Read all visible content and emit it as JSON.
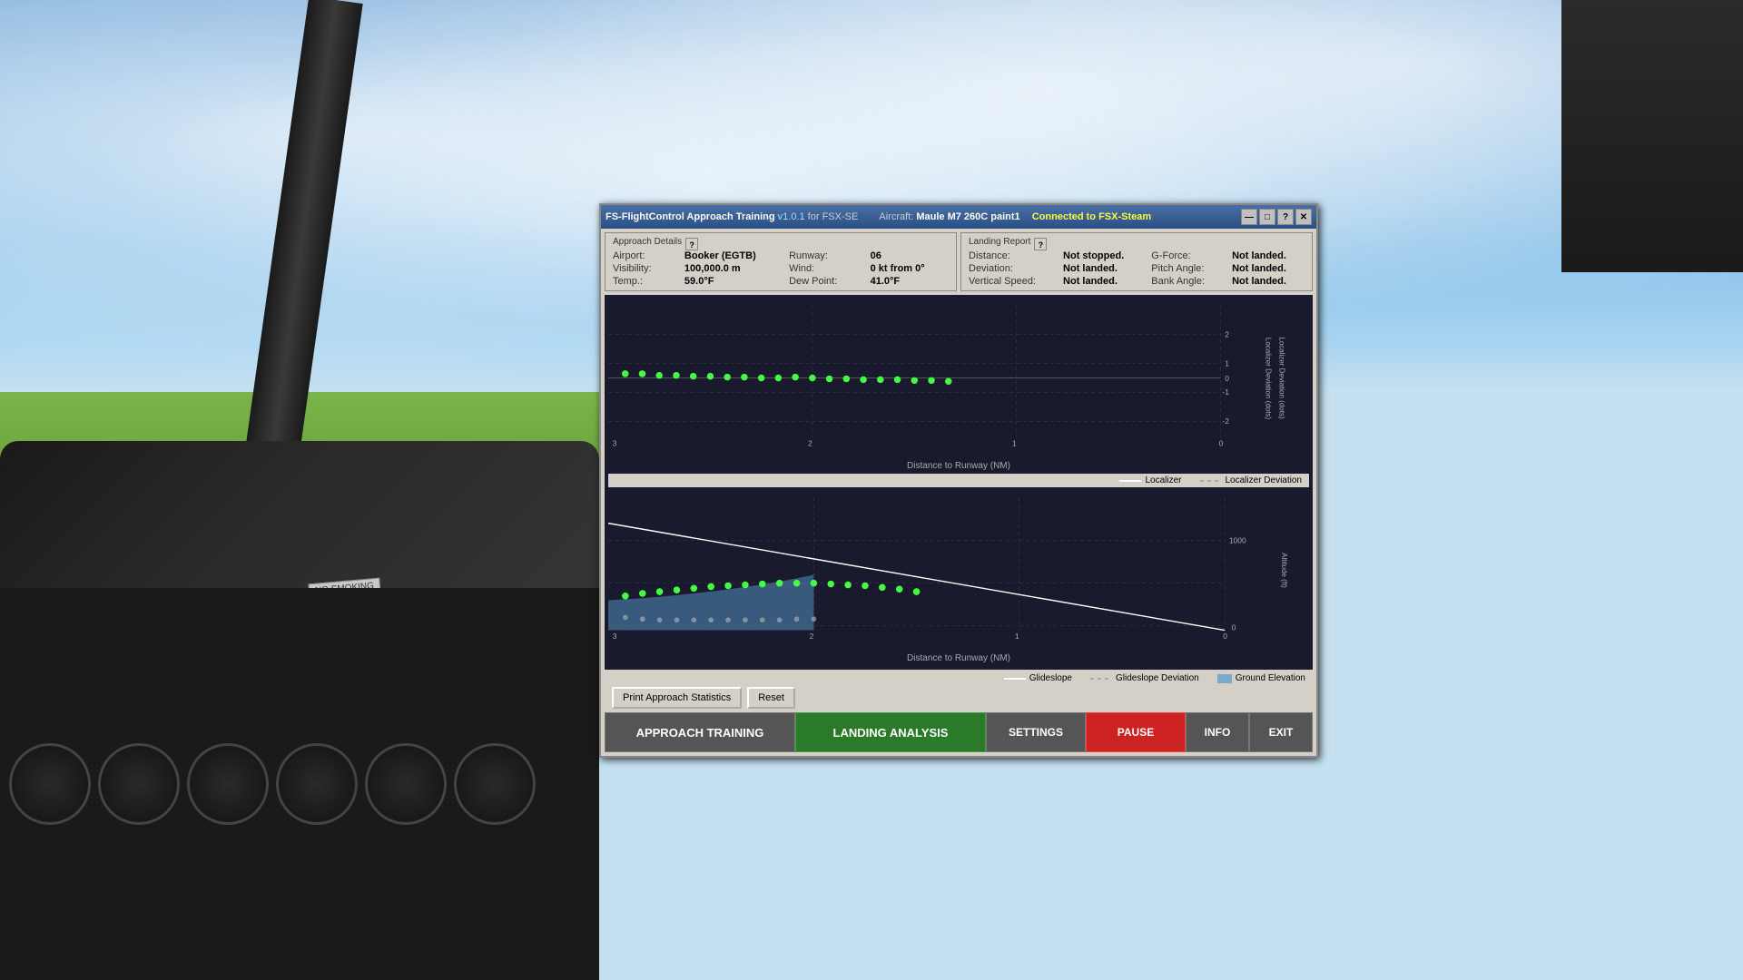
{
  "background": {
    "sky_color": "#6ba3d6",
    "ground_color": "#5a8c30"
  },
  "title_bar": {
    "app_name": "FS-FlightControl Approach Training",
    "version": "v1.0.1",
    "for_label": "for",
    "sim": "FSX-SE",
    "aircraft_label": "Aircraft:",
    "aircraft_name": "Maule M7 260C paint1",
    "connected_label": "Connected to FSX-Steam",
    "minimize_label": "—",
    "restore_label": "□",
    "help_label": "?",
    "close_label": "✕"
  },
  "approach_details": {
    "title": "Approach Details",
    "airport_label": "Airport:",
    "airport_value": "Booker (EGTB)",
    "runway_label": "Runway:",
    "runway_value": "06",
    "visibility_label": "Visibility:",
    "visibility_value": "100,000.0 m",
    "wind_label": "Wind:",
    "wind_value": "0 kt from 0°",
    "temp_label": "Temp.:",
    "temp_value": "59.0°F",
    "dew_point_label": "Dew Point:",
    "dew_point_value": "41.0°F"
  },
  "landing_report": {
    "title": "Landing Report",
    "distance_label": "Distance:",
    "distance_value": "Not stopped.",
    "g_force_label": "G-Force:",
    "g_force_value": "Not landed.",
    "deviation_label": "Deviation:",
    "deviation_value": "Not landed.",
    "pitch_angle_label": "Pitch Angle:",
    "pitch_angle_value": "Not landed.",
    "vertical_speed_label": "Vertical Speed:",
    "vertical_speed_value": "Not landed.",
    "bank_angle_label": "Bank Angle:",
    "bank_angle_value": "Not landed."
  },
  "charts": {
    "localizer_chart": {
      "y_label": "Localizer Deviation (dots)",
      "x_label": "Distance to Runway (NM)",
      "x_ticks": [
        "3",
        "2",
        "1",
        "0"
      ],
      "y_ticks": [
        "2",
        "1",
        "0",
        "-1",
        "-2"
      ]
    },
    "glideslope_chart": {
      "y_label": "Altitude (ft)",
      "x_label": "Distance to Runway (NM)",
      "x_ticks": [
        "3",
        "2",
        "1",
        "0"
      ],
      "y_ticks": [
        "1000",
        "0"
      ]
    },
    "localizer_legend": {
      "localizer_label": "Localizer",
      "deviation_label": "Localizer Deviation"
    },
    "glideslope_legend": {
      "glideslope_label": "Glideslope",
      "deviation_label": "Glideslope Deviation",
      "elevation_label": "Ground Elevation"
    }
  },
  "buttons": {
    "print_stats": "Print Approach Statistics",
    "reset": "Reset",
    "approach_training": "APPROACH TRAINING",
    "landing_analysis": "LANDING ANALYSIS",
    "settings": "SETTINGS",
    "pause": "PAUSE",
    "info": "INFO",
    "exit": "EXIT"
  },
  "cockpit": {
    "no_smoking": "NO SMOKING"
  }
}
